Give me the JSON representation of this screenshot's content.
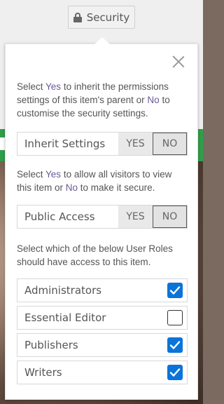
{
  "trigger": {
    "label": "Security"
  },
  "inherit": {
    "desc_pre": "Select ",
    "desc_yes": "Yes",
    "desc_mid": " to inherit the permissions settings of this item's parent or ",
    "desc_no": "No",
    "desc_post": " to customise the security settings.",
    "label": "Inherit Settings",
    "yes": "YES",
    "no": "NO",
    "selected": "NO"
  },
  "public": {
    "desc_pre": "Select ",
    "desc_yes": "Yes",
    "desc_mid": " to allow all visitors to view this item or ",
    "desc_no": "No",
    "desc_post": " to make it secure.",
    "label": "Public Access",
    "yes": "YES",
    "no": "NO",
    "selected": "NO"
  },
  "roles": {
    "desc": "Select which of the below User Roles should have access to this item.",
    "items": [
      {
        "label": "Administrators",
        "checked": true
      },
      {
        "label": "Essential Editor",
        "checked": false
      },
      {
        "label": "Publishers",
        "checked": true
      },
      {
        "label": "Writers",
        "checked": true
      }
    ]
  },
  "colors": {
    "accent": "#6a5a9a",
    "checkbox": "#0b74d8",
    "banner": "#2f9e4a"
  }
}
